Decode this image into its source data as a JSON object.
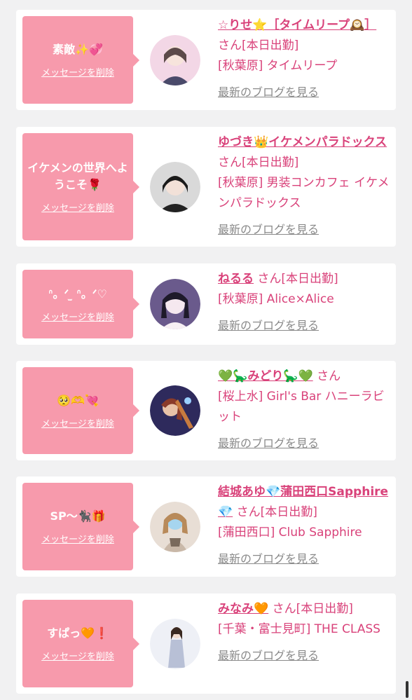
{
  "delete_label": "メッセージを削除",
  "blog_label": "最新のブログを見る",
  "honorific": "さん",
  "colors": {
    "bubble": "#f79aac",
    "accent": "#d9427a",
    "muted": "#8a8a8a",
    "background": "#f1f1f2"
  },
  "cards": [
    {
      "message": "素敵✨💞",
      "name": "☆りせ⭐［タイムリープ🕰️］",
      "badge": "[本日出勤]",
      "shop": "[秋葉原] タイムリープ",
      "avatar_colors": [
        "#f3d7e6",
        "#5c4a4a"
      ]
    },
    {
      "message": "イケメンの世界へようこそ🌹",
      "name": "ゆづき👑イケメンパラドックス",
      "badge": "[本日出勤]",
      "shop": "[秋葉原] 男装コンカフェ イケメンパラドックス",
      "avatar_colors": [
        "#d9d9d9",
        "#1a1a1a"
      ]
    },
    {
      "message": "ᐢ。ᐟ ̫ ᐢ。ᐟ♡",
      "name": "ねるる",
      "badge": "[本日出勤]",
      "shop": "[秋葉原] Alice×Alice",
      "avatar_colors": [
        "#6a5a8c",
        "#f5e8ef"
      ]
    },
    {
      "message": "🥺🫶💘",
      "name": "💚🦕みどり🦕💚",
      "badge": "",
      "shop": "[桜上水] Girl's Bar ハニーラビット",
      "avatar_colors": [
        "#2e2a5c",
        "#c77b3f"
      ]
    },
    {
      "message": "SP〜🐈‍⬛🎁",
      "name": "結城あゆ💎蒲田西口Sapphire💎",
      "badge": "[本日出勤]",
      "shop": "[蒲田西口] Club Sapphire",
      "avatar_colors": [
        "#e8ded5",
        "#c9b8a8"
      ]
    },
    {
      "message": "すぱっ🧡❗",
      "name": "みなみ🧡",
      "badge": "[本日出勤]",
      "shop": "[千葉・富士見町] THE CLASS",
      "avatar_colors": [
        "#eef0f6",
        "#b8c0d6"
      ]
    }
  ]
}
